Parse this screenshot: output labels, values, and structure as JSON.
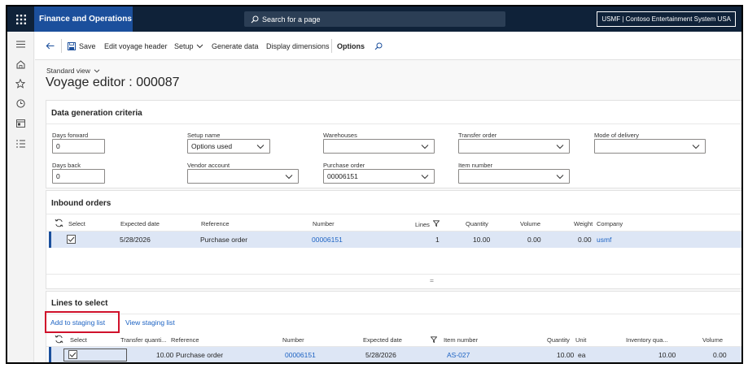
{
  "app": {
    "name": "Finance and Operations"
  },
  "search": {
    "placeholder": "Search for a page"
  },
  "company": {
    "label": "USMF | Contoso Entertainment System USA"
  },
  "actions": {
    "save": "Save",
    "edit_voyage_header": "Edit voyage header",
    "setup": "Setup",
    "generate_data": "Generate data",
    "display_dimensions": "Display dimensions",
    "options": "Options"
  },
  "header": {
    "view": "Standard view",
    "title": "Voyage editor : 000087"
  },
  "criteria": {
    "title": "Data generation criteria",
    "days_forward_label": "Days forward",
    "days_forward_value": "0",
    "days_back_label": "Days back",
    "days_back_value": "0",
    "setup_name_label": "Setup name",
    "setup_name_value": "Options used",
    "vendor_account_label": "Vendor account",
    "vendor_account_value": "",
    "warehouses_label": "Warehouses",
    "warehouses_value": "",
    "purchase_order_label": "Purchase order",
    "purchase_order_value": "00006151",
    "transfer_order_label": "Transfer order",
    "transfer_order_value": "",
    "item_number_label": "Item number",
    "item_number_value": "",
    "mode_of_delivery_label": "Mode of delivery",
    "mode_of_delivery_value": ""
  },
  "inbound": {
    "title": "Inbound orders",
    "columns": [
      "Select",
      "Expected date",
      "Reference",
      "Number",
      "Lines",
      "Quantity",
      "Volume",
      "Weight",
      "Company"
    ],
    "row": {
      "expected_date": "5/28/2026",
      "reference": "Purchase order",
      "number": "00006151",
      "lines": "1",
      "quantity": "10.00",
      "volume": "0.00",
      "weight": "0.00",
      "company": "usmf"
    },
    "splitter": "="
  },
  "lines": {
    "title": "Lines to select",
    "add_to_staging": "Add to staging list",
    "view_staging": "View staging list",
    "columns": [
      "Select",
      "Transfer quanti...",
      "Reference",
      "Number",
      "Expected date",
      "Item number",
      "Quantity",
      "Unit",
      "Inventory qua...",
      "Volume"
    ],
    "row": {
      "transfer_quantity": "10.00",
      "reference": "Purchase order",
      "number": "00006151",
      "expected_date": "5/28/2026",
      "item_number": "AS-027",
      "quantity": "10.00",
      "unit": "ea",
      "inventory_quantity": "10.00",
      "volume": "0.00"
    }
  },
  "colors": {
    "brand": "#1b4f9c",
    "topbar": "#0f2239",
    "highlight": "#d0112b",
    "link": "#1d63c3"
  }
}
